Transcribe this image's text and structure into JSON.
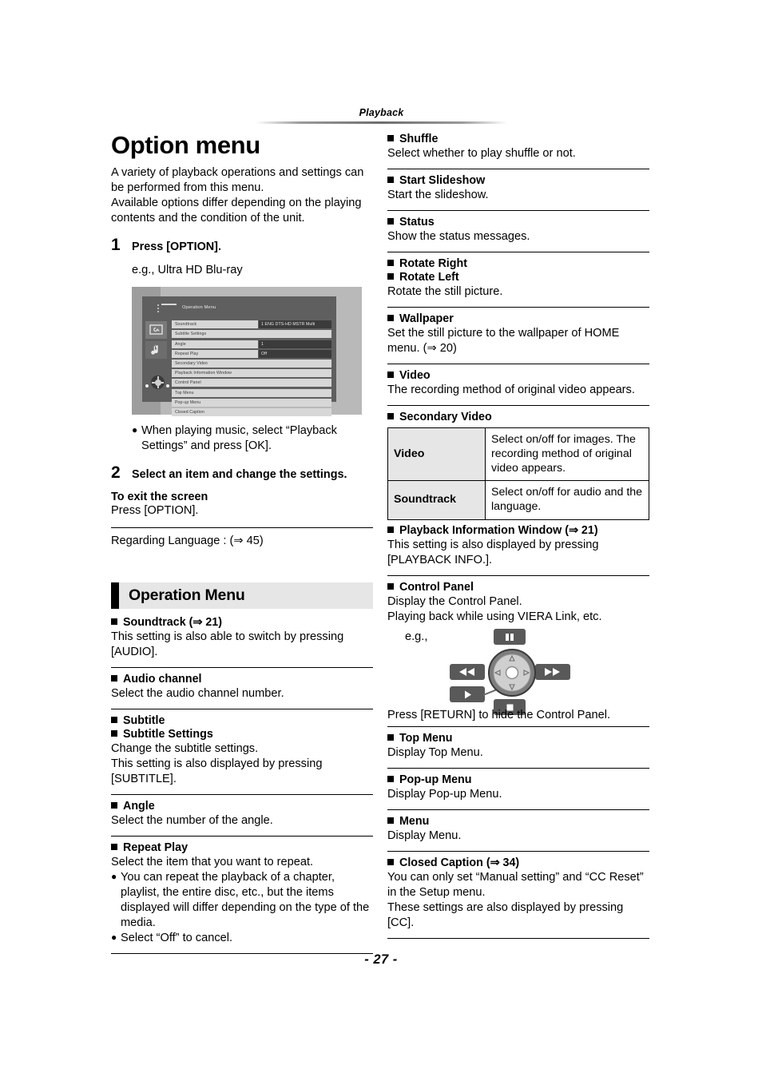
{
  "header": {
    "running_head": "Playback"
  },
  "footer": {
    "page_number": "- 27 -"
  },
  "left": {
    "title": "Option menu",
    "intro": "A variety of playback operations and settings can be performed from this menu.\nAvailable options differ depending on the playing contents and the condition of the unit.",
    "step1": {
      "num": "1",
      "text": "Press [OPTION]."
    },
    "eg_label": "e.g., Ultra HD Blu-ray",
    "screenshot": {
      "panel_title": "Operation Menu",
      "hamburger_icon": "list-icon",
      "tab_icons": [
        "video-settings-icon",
        "music-note-icon"
      ],
      "dpad_icon": "dpad-icon",
      "rows": [
        {
          "label": "Soundtrack",
          "value": "1 ENG DTS-HD MSTR Multi"
        },
        {
          "label": "Subtitle Settings",
          "value": ""
        },
        {
          "label": "Angle",
          "value": "1"
        },
        {
          "label": "Repeat Play",
          "value": "Off"
        },
        {
          "label": "Secondary Video",
          "value": ""
        },
        {
          "label": "Playback Information Window",
          "value": ""
        },
        {
          "label": "Control Panel",
          "value": ""
        },
        {
          "label": "Top Menu",
          "value": ""
        },
        {
          "label": "Pop-up Menu",
          "value": ""
        },
        {
          "label": "Closed Caption",
          "value": ""
        }
      ]
    },
    "note1": "When playing music, select “Playback Settings” and press [OK].",
    "step2": {
      "num": "2",
      "text": "Select an item and change the settings."
    },
    "exit_head": "To exit the screen",
    "exit_body": "Press [OPTION].",
    "regarding_language": "Regarding Language : (⇒ 45)",
    "band_title": "Operation Menu",
    "items": [
      {
        "head": "Soundtrack (⇒ 21)",
        "body": "This setting is also able to switch by pressing [AUDIO]."
      },
      {
        "head": "Audio channel",
        "body": "Select the audio channel number."
      },
      {
        "head": "Subtitle",
        "head2": "Subtitle Settings",
        "body": "Change the subtitle settings.\nThis setting is also displayed by pressing [SUBTITLE]."
      },
      {
        "head": "Angle",
        "body": "Select the number of the angle."
      },
      {
        "head": "Repeat Play",
        "body": "Select the item that you want to repeat.",
        "bullets": [
          "You can repeat the playback of a chapter, playlist, the entire disc, etc., but the items displayed will differ depending on the type of the media.",
          "Select “Off” to cancel."
        ]
      }
    ]
  },
  "right": {
    "items": [
      {
        "head": "Shuffle",
        "body": "Select whether to play shuffle or not."
      },
      {
        "head": "Start Slideshow",
        "body": "Start the slideshow."
      },
      {
        "head": "Status",
        "body": "Show the status messages."
      },
      {
        "head": "Rotate Right",
        "head2": "Rotate Left",
        "body": "Rotate the still picture."
      },
      {
        "head": "Wallpaper",
        "body": "Set the still picture to the wallpaper of HOME menu. (⇒ 20)"
      },
      {
        "head": "Video",
        "body": "The recording method of original video appears."
      }
    ],
    "secondary_video": {
      "head": "Secondary Video",
      "rows": [
        {
          "key": "Video",
          "value": "Select on/off for images. The recording method of original video appears."
        },
        {
          "key": "Soundtrack",
          "value": "Select on/off for audio and the language."
        }
      ]
    },
    "playback_info": {
      "head": "Playback Information Window (⇒ 21)",
      "body": "This setting is also displayed by pressing [PLAYBACK INFO.]."
    },
    "control_panel": {
      "head": "Control Panel",
      "body": "Display the Control Panel.\nPlaying back while using VIERA Link, etc.",
      "eg_label": "e.g.,",
      "buttons": [
        "pause-icon",
        "rewind-icon",
        "fast-forward-icon",
        "play-icon",
        "stop-icon"
      ],
      "after": "Press [RETURN] to hide the Control Panel."
    },
    "items_tail": [
      {
        "head": "Top Menu",
        "body": "Display Top Menu."
      },
      {
        "head": "Pop-up Menu",
        "body": "Display Pop-up Menu."
      },
      {
        "head": "Menu",
        "body": "Display Menu."
      },
      {
        "head": "Closed Caption (⇒ 34)",
        "body": "You can only set “Manual setting” and “CC Reset” in the Setup menu.\nThese settings are also displayed by pressing [CC]."
      }
    ]
  }
}
